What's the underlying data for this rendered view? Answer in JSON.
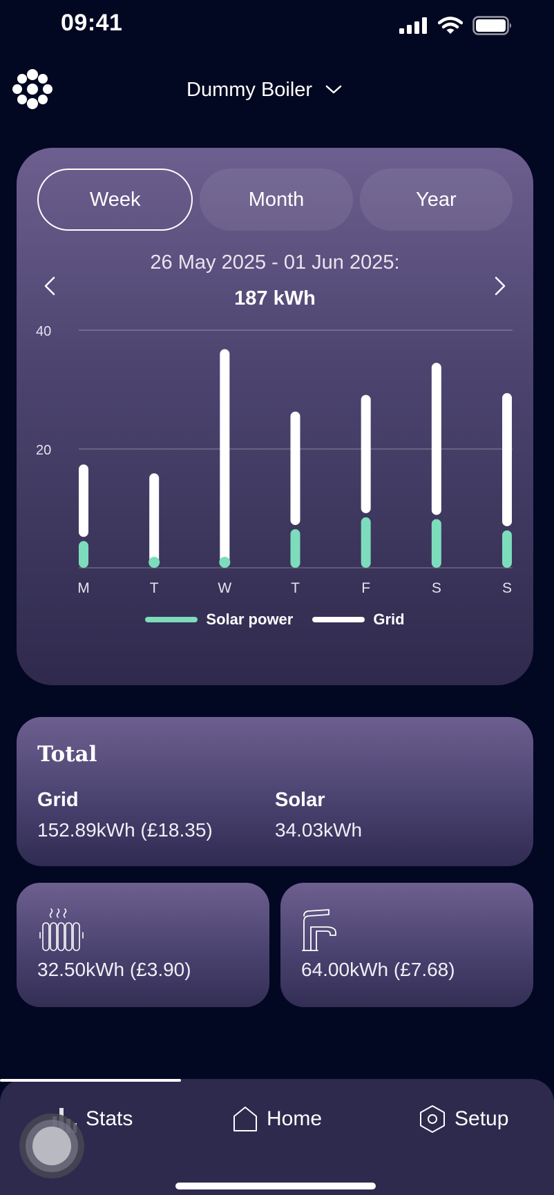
{
  "status_bar": {
    "time": "09:41",
    "icons": [
      "cellular-signal-icon",
      "wifi-icon",
      "battery-icon"
    ]
  },
  "header": {
    "logo_icon": "brand-dots-logo",
    "device_name": "Dummy Boiler",
    "dropdown_icon": "chevron-down-icon"
  },
  "period_tabs": [
    {
      "label": "Week",
      "selected": true
    },
    {
      "label": "Month",
      "selected": false
    },
    {
      "label": "Year",
      "selected": false
    }
  ],
  "range": {
    "label": "26 May 2025 - 01 Jun 2025:",
    "total": "187 kWh",
    "prev_icon": "chevron-left-icon",
    "next_icon": "chevron-right-icon"
  },
  "chart_data": {
    "type": "bar",
    "stacked": true,
    "categories": [
      "M",
      "T",
      "W",
      "T",
      "F",
      "S",
      "S"
    ],
    "series": [
      {
        "name": "Solar power",
        "color": "#7ddcbc",
        "values": [
          4.5,
          0.5,
          0.5,
          6.5,
          8.5,
          8.2,
          6.3
        ]
      },
      {
        "name": "Grid",
        "color": "#ffffff",
        "values": [
          12.9,
          15.4,
          36.3,
          19.8,
          20.6,
          26.3,
          23.1
        ]
      }
    ],
    "yticks": [
      20,
      40
    ],
    "ylim": [
      0,
      40
    ],
    "grid": true,
    "legend_position": "bottom-center"
  },
  "total": {
    "title": "Total",
    "grid_label": "Grid",
    "grid_value": "152.89kWh (£18.35)",
    "solar_label": "Solar",
    "solar_value": "34.03kWh"
  },
  "usage_cards": [
    {
      "icon": "radiator-heating-icon",
      "value": "32.50kWh (£3.90)"
    },
    {
      "icon": "water-tap-icon",
      "value": "64.00kWh (£7.68)"
    }
  ],
  "bottom_nav": [
    {
      "label": "Stats",
      "icon": "bar-chart-icon",
      "active": true
    },
    {
      "label": "Home",
      "icon": "home-icon",
      "active": false
    },
    {
      "label": "Setup",
      "icon": "hexagon-settings-icon",
      "active": false
    }
  ],
  "colors": {
    "background": "#030822",
    "card_top": "#6d5f8f",
    "card_bottom": "#2f2a4d",
    "solar": "#7ddcbc",
    "grid": "#ffffff",
    "nav_bar": "#2d2a4d"
  }
}
